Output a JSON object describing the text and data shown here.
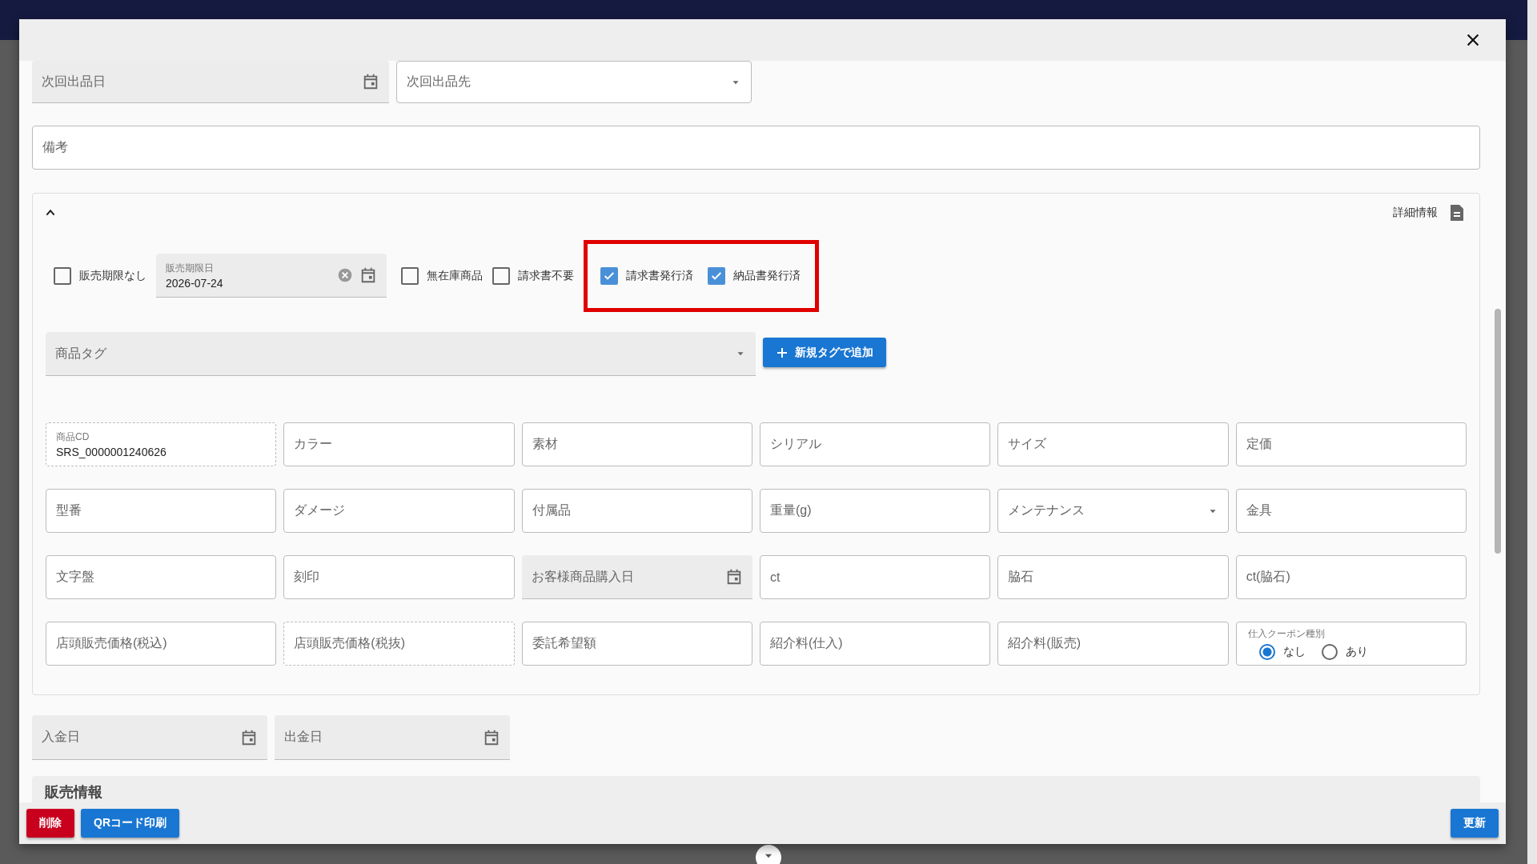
{
  "top_fields": [
    {
      "kind": "date",
      "placeholder": "次回出品日"
    },
    {
      "kind": "select",
      "placeholder": "次回出品先"
    }
  ],
  "remarks": {
    "placeholder": "備考"
  },
  "details": {
    "expanded": true,
    "title": "詳細情報",
    "options": [
      {
        "kind": "checkbox",
        "label": "販売期限なし",
        "checked": false,
        "highlighted": false
      },
      {
        "kind": "date",
        "label": "販売期限日",
        "value": "2026-07-24",
        "highlighted": false
      },
      {
        "kind": "checkbox",
        "label": "無在庫商品",
        "checked": false,
        "highlighted": false
      },
      {
        "kind": "checkbox",
        "label": "請求書不要",
        "checked": false,
        "highlighted": false
      },
      {
        "kind": "checkbox",
        "label": "請求書発行済",
        "checked": true,
        "highlighted": true
      },
      {
        "kind": "checkbox",
        "label": "納品書発行済",
        "checked": true,
        "highlighted": true
      }
    ],
    "tag_field": {
      "placeholder": "商品タグ"
    },
    "add_tag_button": "新規タグで追加",
    "fields": [
      {
        "kind": "readonly",
        "label": "商品CD",
        "value": "SRS_0000001240626"
      },
      {
        "kind": "text",
        "placeholder": "カラー"
      },
      {
        "kind": "text",
        "placeholder": "素材"
      },
      {
        "kind": "text",
        "placeholder": "シリアル"
      },
      {
        "kind": "text",
        "placeholder": "サイズ"
      },
      {
        "kind": "text",
        "placeholder": "定価"
      },
      {
        "kind": "text",
        "placeholder": "型番"
      },
      {
        "kind": "text",
        "placeholder": "ダメージ"
      },
      {
        "kind": "text",
        "placeholder": "付属品"
      },
      {
        "kind": "text",
        "placeholder": "重量(g)"
      },
      {
        "kind": "select",
        "placeholder": "メンテナンス"
      },
      {
        "kind": "text",
        "placeholder": "金具"
      },
      {
        "kind": "text",
        "placeholder": "文字盤"
      },
      {
        "kind": "text",
        "placeholder": "刻印"
      },
      {
        "kind": "date",
        "placeholder": "お客様商品購入日"
      },
      {
        "kind": "text",
        "placeholder": "ct"
      },
      {
        "kind": "text",
        "placeholder": "脇石"
      },
      {
        "kind": "text",
        "placeholder": "ct(脇石)"
      },
      {
        "kind": "text",
        "placeholder": "店頭販売価格(税込)"
      },
      {
        "kind": "readonly",
        "placeholder": "店頭販売価格(税抜)"
      },
      {
        "kind": "text",
        "placeholder": "委託希望額"
      },
      {
        "kind": "text",
        "placeholder": "紹介料(仕入)"
      },
      {
        "kind": "text",
        "placeholder": "紹介料(販売)"
      },
      {
        "kind": "radio",
        "label": "仕入クーポン種別",
        "options": [
          {
            "label": "なし",
            "selected": true
          },
          {
            "label": "あり",
            "selected": false
          }
        ]
      }
    ]
  },
  "payment_fields": [
    {
      "kind": "date",
      "placeholder": "入金日"
    },
    {
      "kind": "date",
      "placeholder": "出金日"
    }
  ],
  "sales_section": {
    "title": "販売情報"
  },
  "footer": {
    "left_buttons": [
      {
        "kind": "danger",
        "label": "削除"
      },
      {
        "kind": "primary",
        "label": "QRコード印刷"
      }
    ],
    "right_buttons": [
      {
        "kind": "primary",
        "label": "更新"
      }
    ]
  }
}
